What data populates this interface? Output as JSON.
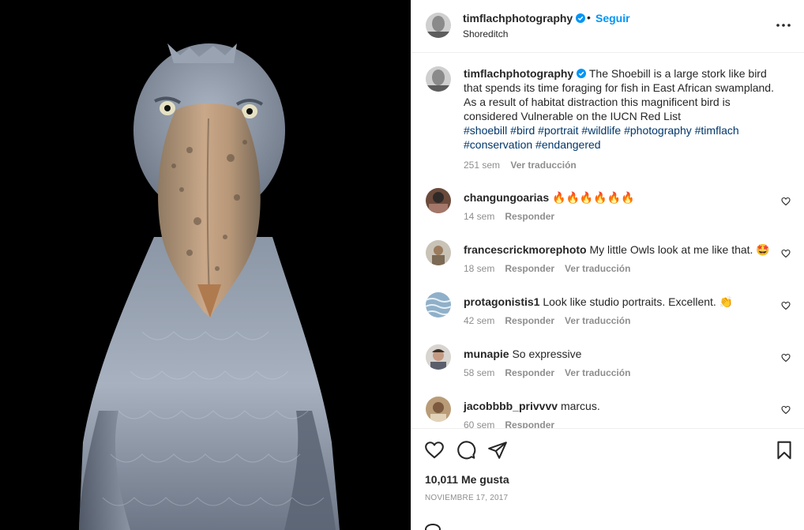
{
  "header": {
    "username": "timflachphotography",
    "separator": "•",
    "follow_label": "Seguir",
    "location": "Shoreditch"
  },
  "caption": {
    "username": "timflachphotography",
    "text": "The Shoebill is a large stork like bird that spends its time foraging for fish in East African swampland. As a result of habitat distraction this magnificent bird is considered Vulnerable on the IUCN Red List",
    "hashtags": "#shoebill #bird #portrait #wildlife #photography #timflach #conservation #endangered",
    "age": "251 sem",
    "translate_label": "Ver traducción"
  },
  "comments": [
    {
      "username": "changungoarias",
      "text": "🔥🔥🔥🔥🔥🔥",
      "age": "14 sem",
      "reply_label": "Responder",
      "translate_label": ""
    },
    {
      "username": "francescrickmorephoto",
      "text": "My little Owls look at me like that. 🤩",
      "age": "18 sem",
      "reply_label": "Responder",
      "translate_label": "Ver traducción"
    },
    {
      "username": "protagonistis1",
      "text": "Look like studio portraits. Excellent. 👏",
      "age": "42 sem",
      "reply_label": "Responder",
      "translate_label": "Ver traducción"
    },
    {
      "username": "munapie",
      "text": "So expressive",
      "age": "58 sem",
      "reply_label": "Responder",
      "translate_label": "Ver traducción"
    },
    {
      "username": "jacobbbb_privvvv",
      "text": "marcus.",
      "age": "60 sem",
      "reply_label": "Responder",
      "translate_label": ""
    }
  ],
  "footer": {
    "likes": "10,011 Me gusta",
    "date": "NOVIEMBRE 17, 2017"
  },
  "icons": {
    "verified": "verified-badge-icon",
    "more": "more-options-icon",
    "like": "heart-icon",
    "comment": "comment-icon",
    "share": "paper-plane-icon",
    "save": "bookmark-icon"
  },
  "colors": {
    "accent": "#0095f6",
    "hashtag": "#00376b",
    "muted": "#8e8e8e",
    "text": "#262626",
    "media_bg": "#000000"
  }
}
